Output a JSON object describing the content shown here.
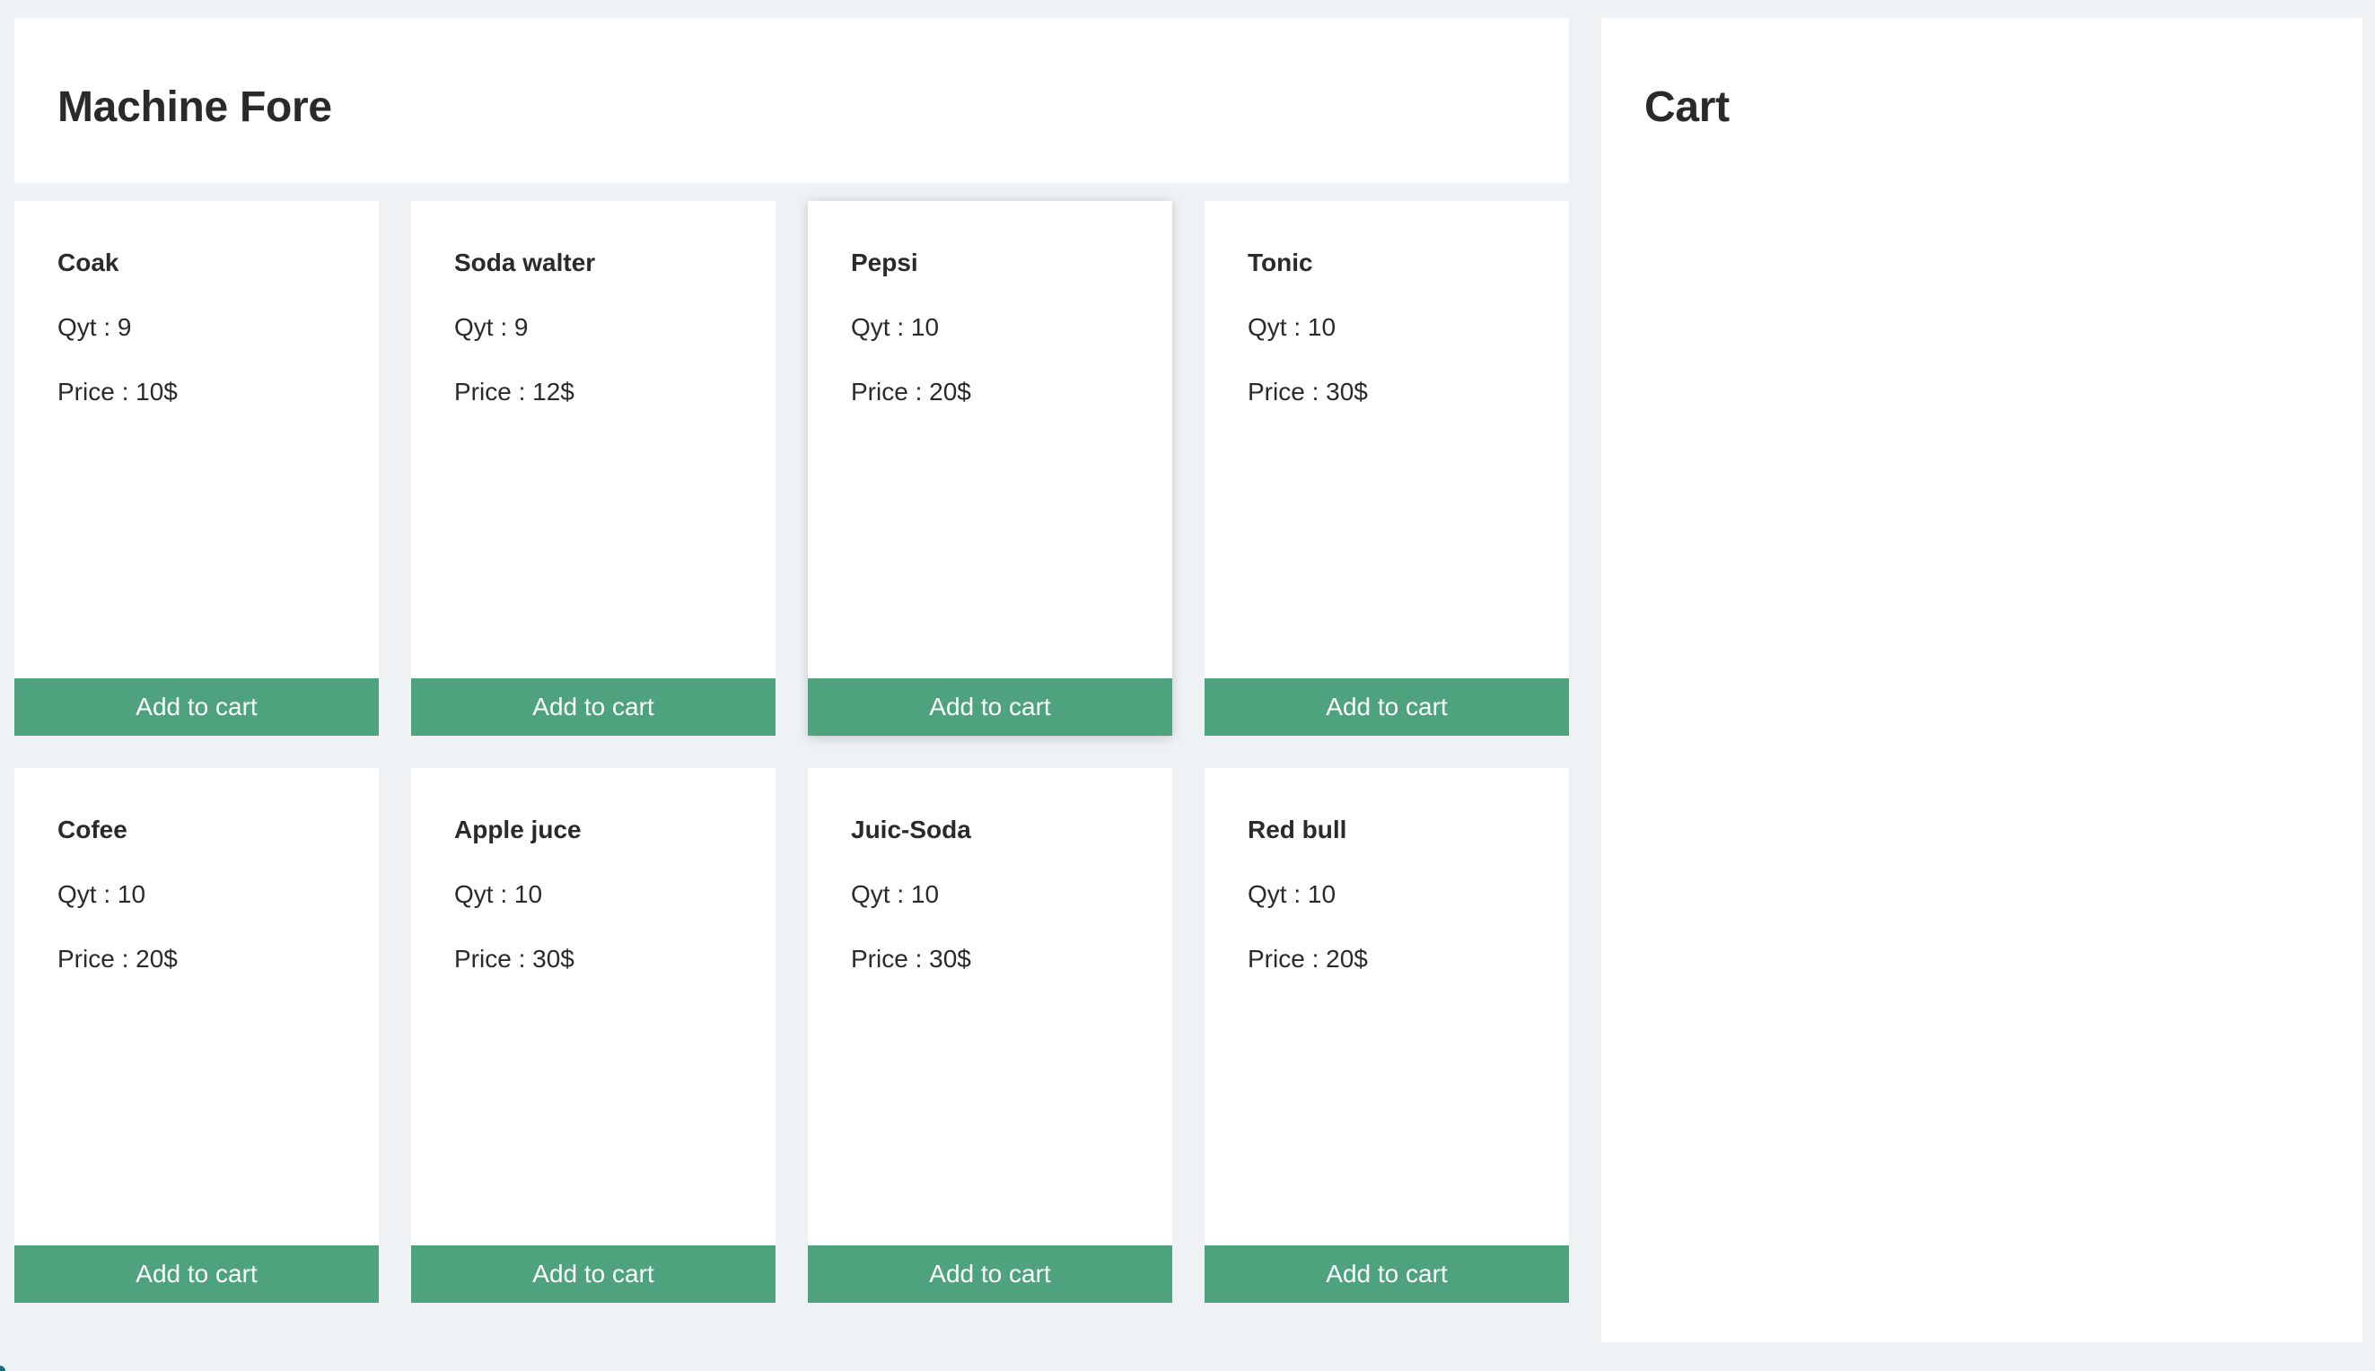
{
  "header": {
    "title": "Machine Fore"
  },
  "cart": {
    "title": "Cart"
  },
  "products": [
    {
      "name": "Coak",
      "qty": "Qyt : 9",
      "price": "Price : 10$",
      "button": "Add to cart"
    },
    {
      "name": "Soda walter",
      "qty": "Qyt : 9",
      "price": "Price : 12$",
      "button": "Add to cart"
    },
    {
      "name": "Pepsi",
      "qty": "Qyt : 10",
      "price": "Price : 20$",
      "button": "Add to cart"
    },
    {
      "name": "Tonic",
      "qty": "Qyt : 10",
      "price": "Price : 30$",
      "button": "Add to cart"
    },
    {
      "name": "Cofee",
      "qty": "Qyt : 10",
      "price": "Price : 20$",
      "button": "Add to cart"
    },
    {
      "name": "Apple juce",
      "qty": "Qyt : 10",
      "price": "Price : 30$",
      "button": "Add to cart"
    },
    {
      "name": "Juic-Soda",
      "qty": "Qyt : 10",
      "price": "Price : 30$",
      "button": "Add to cart"
    },
    {
      "name": "Red bull",
      "qty": "Qyt : 10",
      "price": "Price : 20$",
      "button": "Add to cart"
    }
  ],
  "colors": {
    "background": "#eff2f5",
    "panel": "#ffffff",
    "button": "#4ea37e",
    "button_text": "#ffffff"
  }
}
